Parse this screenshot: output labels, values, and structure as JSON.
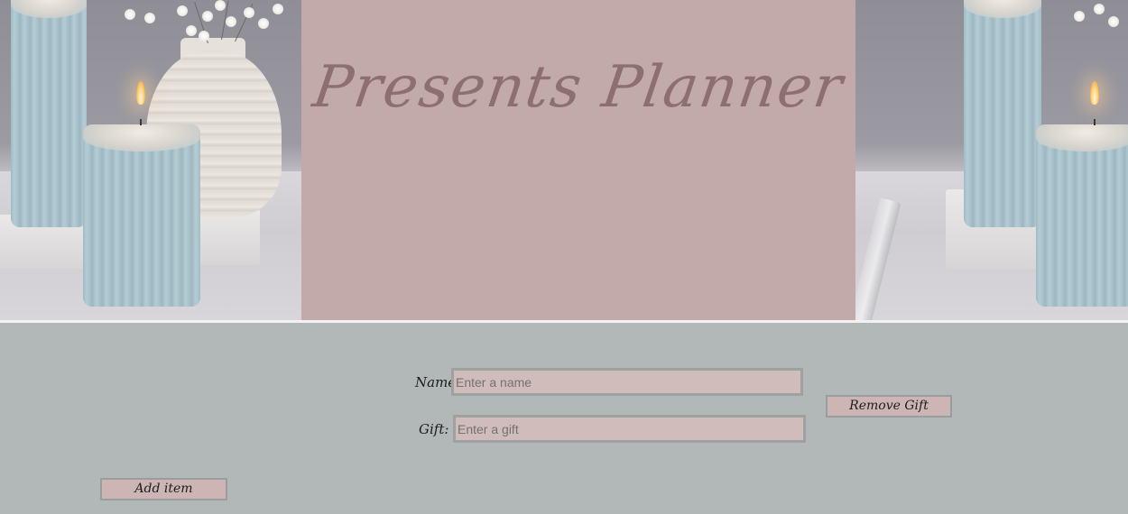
{
  "header": {
    "title": "Presents Planner"
  },
  "form": {
    "name_label": "Name:",
    "name_placeholder": "Enter a name",
    "name_value": "",
    "gift_label": "Gift:",
    "gift_placeholder": "Enter a gift",
    "gift_value": ""
  },
  "actions": {
    "remove_label": "Remove Gift",
    "add_label": "Add item"
  },
  "colors": {
    "title_panel": "#c2a9aa",
    "title_text": "#8e6f70",
    "page_background": "#b2b8b8",
    "input_background": "#d1bcbc",
    "button_background": "#cdb5b6"
  }
}
